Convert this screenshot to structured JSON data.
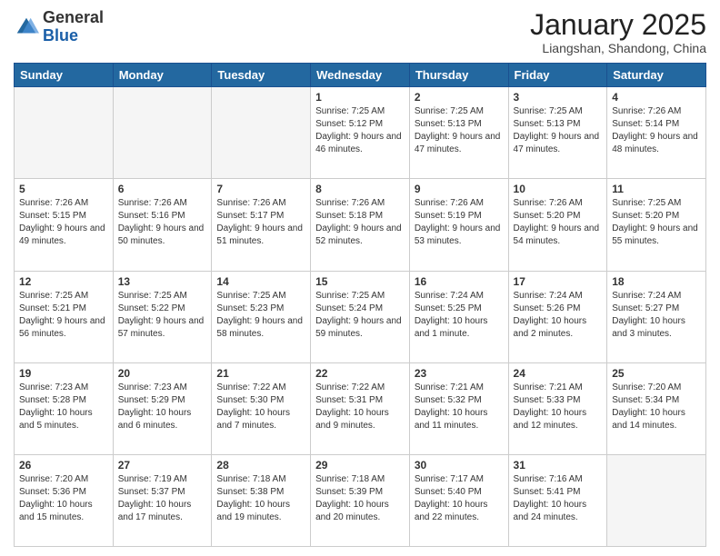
{
  "header": {
    "logo": {
      "general": "General",
      "blue": "Blue"
    },
    "title": "January 2025",
    "subtitle": "Liangshan, Shandong, China"
  },
  "weekdays": [
    "Sunday",
    "Monday",
    "Tuesday",
    "Wednesday",
    "Thursday",
    "Friday",
    "Saturday"
  ],
  "weeks": [
    [
      {
        "day": "",
        "empty": true
      },
      {
        "day": "",
        "empty": true
      },
      {
        "day": "",
        "empty": true
      },
      {
        "day": "1",
        "sunrise": "7:25 AM",
        "sunset": "5:12 PM",
        "daylight": "9 hours and 46 minutes."
      },
      {
        "day": "2",
        "sunrise": "7:25 AM",
        "sunset": "5:13 PM",
        "daylight": "9 hours and 47 minutes."
      },
      {
        "day": "3",
        "sunrise": "7:25 AM",
        "sunset": "5:13 PM",
        "daylight": "9 hours and 47 minutes."
      },
      {
        "day": "4",
        "sunrise": "7:26 AM",
        "sunset": "5:14 PM",
        "daylight": "9 hours and 48 minutes."
      }
    ],
    [
      {
        "day": "5",
        "sunrise": "7:26 AM",
        "sunset": "5:15 PM",
        "daylight": "9 hours and 49 minutes."
      },
      {
        "day": "6",
        "sunrise": "7:26 AM",
        "sunset": "5:16 PM",
        "daylight": "9 hours and 50 minutes."
      },
      {
        "day": "7",
        "sunrise": "7:26 AM",
        "sunset": "5:17 PM",
        "daylight": "9 hours and 51 minutes."
      },
      {
        "day": "8",
        "sunrise": "7:26 AM",
        "sunset": "5:18 PM",
        "daylight": "9 hours and 52 minutes."
      },
      {
        "day": "9",
        "sunrise": "7:26 AM",
        "sunset": "5:19 PM",
        "daylight": "9 hours and 53 minutes."
      },
      {
        "day": "10",
        "sunrise": "7:26 AM",
        "sunset": "5:20 PM",
        "daylight": "9 hours and 54 minutes."
      },
      {
        "day": "11",
        "sunrise": "7:25 AM",
        "sunset": "5:20 PM",
        "daylight": "9 hours and 55 minutes."
      }
    ],
    [
      {
        "day": "12",
        "sunrise": "7:25 AM",
        "sunset": "5:21 PM",
        "daylight": "9 hours and 56 minutes."
      },
      {
        "day": "13",
        "sunrise": "7:25 AM",
        "sunset": "5:22 PM",
        "daylight": "9 hours and 57 minutes."
      },
      {
        "day": "14",
        "sunrise": "7:25 AM",
        "sunset": "5:23 PM",
        "daylight": "9 hours and 58 minutes."
      },
      {
        "day": "15",
        "sunrise": "7:25 AM",
        "sunset": "5:24 PM",
        "daylight": "9 hours and 59 minutes."
      },
      {
        "day": "16",
        "sunrise": "7:24 AM",
        "sunset": "5:25 PM",
        "daylight": "10 hours and 1 minute."
      },
      {
        "day": "17",
        "sunrise": "7:24 AM",
        "sunset": "5:26 PM",
        "daylight": "10 hours and 2 minutes."
      },
      {
        "day": "18",
        "sunrise": "7:24 AM",
        "sunset": "5:27 PM",
        "daylight": "10 hours and 3 minutes."
      }
    ],
    [
      {
        "day": "19",
        "sunrise": "7:23 AM",
        "sunset": "5:28 PM",
        "daylight": "10 hours and 5 minutes."
      },
      {
        "day": "20",
        "sunrise": "7:23 AM",
        "sunset": "5:29 PM",
        "daylight": "10 hours and 6 minutes."
      },
      {
        "day": "21",
        "sunrise": "7:22 AM",
        "sunset": "5:30 PM",
        "daylight": "10 hours and 7 minutes."
      },
      {
        "day": "22",
        "sunrise": "7:22 AM",
        "sunset": "5:31 PM",
        "daylight": "10 hours and 9 minutes."
      },
      {
        "day": "23",
        "sunrise": "7:21 AM",
        "sunset": "5:32 PM",
        "daylight": "10 hours and 11 minutes."
      },
      {
        "day": "24",
        "sunrise": "7:21 AM",
        "sunset": "5:33 PM",
        "daylight": "10 hours and 12 minutes."
      },
      {
        "day": "25",
        "sunrise": "7:20 AM",
        "sunset": "5:34 PM",
        "daylight": "10 hours and 14 minutes."
      }
    ],
    [
      {
        "day": "26",
        "sunrise": "7:20 AM",
        "sunset": "5:36 PM",
        "daylight": "10 hours and 15 minutes."
      },
      {
        "day": "27",
        "sunrise": "7:19 AM",
        "sunset": "5:37 PM",
        "daylight": "10 hours and 17 minutes."
      },
      {
        "day": "28",
        "sunrise": "7:18 AM",
        "sunset": "5:38 PM",
        "daylight": "10 hours and 19 minutes."
      },
      {
        "day": "29",
        "sunrise": "7:18 AM",
        "sunset": "5:39 PM",
        "daylight": "10 hours and 20 minutes."
      },
      {
        "day": "30",
        "sunrise": "7:17 AM",
        "sunset": "5:40 PM",
        "daylight": "10 hours and 22 minutes."
      },
      {
        "day": "31",
        "sunrise": "7:16 AM",
        "sunset": "5:41 PM",
        "daylight": "10 hours and 24 minutes."
      },
      {
        "day": "",
        "empty": true
      }
    ]
  ]
}
